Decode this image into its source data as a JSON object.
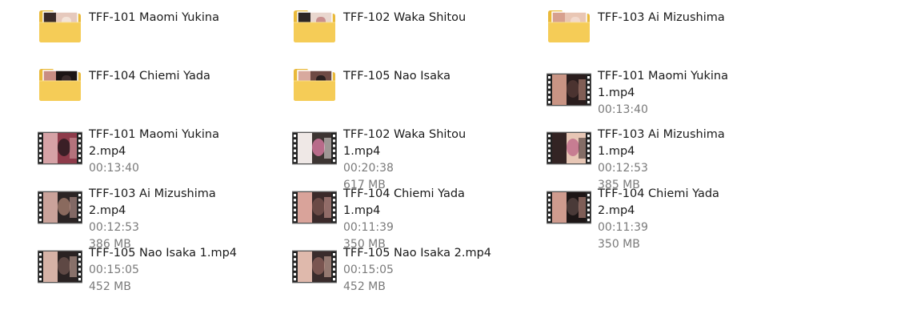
{
  "files": [
    {
      "type": "folder",
      "name": "TFF-101 Maomi Yukina",
      "duration": "",
      "size": "",
      "colors": [
        "#e6c9bd",
        "#3a2a28",
        "#f3e3d8"
      ]
    },
    {
      "type": "folder",
      "name": "TFF-102 Waka Shitou",
      "duration": "",
      "size": "",
      "colors": [
        "#e9d7cf",
        "#2c2626",
        "#c98f8e"
      ]
    },
    {
      "type": "folder",
      "name": "TFF-103 Ai Mizushima",
      "duration": "",
      "size": "",
      "colors": [
        "#e9c6b4",
        "#d7a08e",
        "#f2d9cc"
      ]
    },
    {
      "type": "folder",
      "name": "TFF-104 Chiemi Yada",
      "duration": "",
      "size": "",
      "colors": [
        "#1c1414",
        "#c98d83",
        "#3a2b2b"
      ]
    },
    {
      "type": "folder",
      "name": "TFF-105 Nao Isaka",
      "duration": "",
      "size": "",
      "colors": [
        "#6e4a44",
        "#d8a99e",
        "#2a2020"
      ]
    },
    {
      "type": "video",
      "name": "TFF-101 Maomi Yukina 1.mp4",
      "duration": "00:13:40",
      "size": "",
      "colors": [
        "#2a1d1d",
        "#c99484",
        "#4b3330"
      ]
    },
    {
      "type": "video",
      "name": "TFF-101 Maomi Yukina 2.mp4",
      "duration": "00:13:40",
      "size": "",
      "colors": [
        "#8e3b4a",
        "#d6a2a6",
        "#3a1f26"
      ]
    },
    {
      "type": "video",
      "name": "TFF-102 Waka Shitou 1.mp4",
      "duration": "00:20:38",
      "size": "617 MB",
      "colors": [
        "#3d3533",
        "#efe8e6",
        "#b86b8a"
      ]
    },
    {
      "type": "video",
      "name": "TFF-103 Ai Mizushima 1.mp4",
      "duration": "00:12:53",
      "size": "385 MB",
      "colors": [
        "#e7c6b5",
        "#332424",
        "#c77d92"
      ]
    },
    {
      "type": "video",
      "name": "TFF-103 Ai Mizushima 2.mp4",
      "duration": "00:12:53",
      "size": "386 MB",
      "colors": [
        "#2b2424",
        "#caa29a",
        "#8a6a5e"
      ]
    },
    {
      "type": "video",
      "name": "TFF-104 Chiemi Yada 1.mp4",
      "duration": "00:11:39",
      "size": "350 MB",
      "colors": [
        "#3b2a2a",
        "#d9a39a",
        "#6a4a46"
      ]
    },
    {
      "type": "video",
      "name": "TFF-104 Chiemi Yada 2.mp4",
      "duration": "00:11:39",
      "size": "350 MB",
      "colors": [
        "#1d1616",
        "#cf9b8e",
        "#4a3a38"
      ]
    },
    {
      "type": "video",
      "name": "TFF-105 Nao Isaka 1.mp4",
      "duration": "00:15:05",
      "size": "452 MB",
      "colors": [
        "#2a2222",
        "#d6b2a6",
        "#5e4844"
      ]
    },
    {
      "type": "video",
      "name": "TFF-105 Nao Isaka 2.mp4",
      "duration": "00:15:05",
      "size": "452 MB",
      "colors": [
        "#3a2c2c",
        "#dfb9ac",
        "#7a5550"
      ]
    }
  ]
}
